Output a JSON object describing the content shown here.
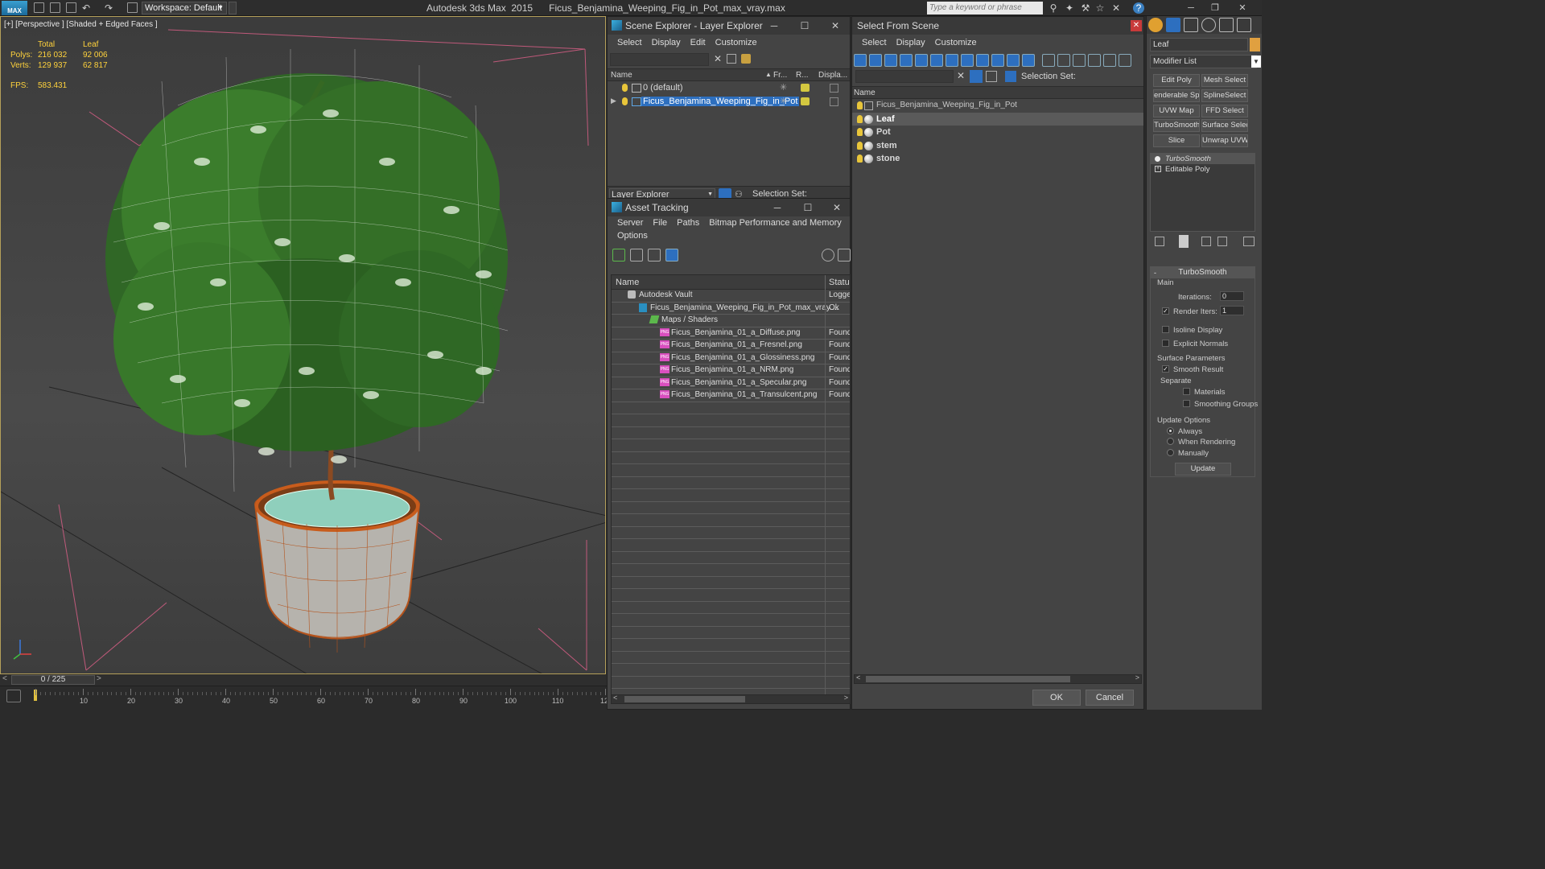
{
  "titlebar": {
    "workspace": "Workspace: Default",
    "app_name": "Autodesk 3ds Max  2015",
    "file_name": "Ficus_Benjamina_Weeping_Fig_in_Pot_max_vray.max",
    "search_placeholder": "Type a keyword or phrase",
    "logo_text": "MAX"
  },
  "viewport": {
    "label": "[+] [Perspective ] [Shaded + Edged Faces ]",
    "stats_headers": [
      "Total",
      "Leaf"
    ],
    "stats": [
      {
        "label": "Polys:",
        "total": "216 032",
        "selected": "92 006"
      },
      {
        "label": "Verts:",
        "total": "129 937",
        "selected": "62 817"
      }
    ],
    "fps_label": "FPS:",
    "fps_value": "583.431"
  },
  "timeline": {
    "frame": "0 / 225",
    "ticks": [
      "10",
      "20",
      "30",
      "40",
      "50",
      "60",
      "70",
      "80",
      "90",
      "100",
      "110",
      "12"
    ]
  },
  "scene_explorer": {
    "title": "Scene Explorer - Layer Explorer",
    "menu": [
      "Select",
      "Display",
      "Edit",
      "Customize"
    ],
    "columns": [
      "Name",
      "Fr...",
      "R...",
      "Displa..."
    ],
    "rows": [
      {
        "name": "0 (default)"
      },
      {
        "name": "Ficus_Benjamina_Weeping_Fig_in_Pot"
      }
    ],
    "footer_mode": "Layer Explorer",
    "selection_set_label": "Selection Set:"
  },
  "asset_tracking": {
    "title": "Asset Tracking",
    "menu": [
      "Server",
      "File",
      "Paths",
      "Bitmap Performance and Memory"
    ],
    "menu2": [
      "Options"
    ],
    "columns": [
      "Name",
      "Status"
    ],
    "rows": [
      {
        "name": "Autodesk Vault",
        "status": "Logge"
      },
      {
        "name": "Ficus_Benjamina_Weeping_Fig_in_Pot_max_vray....",
        "status": "Ok"
      },
      {
        "name": "Maps / Shaders",
        "status": ""
      },
      {
        "name": "Ficus_Benjamina_01_a_Diffuse.png",
        "status": "Found"
      },
      {
        "name": "Ficus_Benjamina_01_a_Fresnel.png",
        "status": "Found"
      },
      {
        "name": "Ficus_Benjamina_01_a_Glossiness.png",
        "status": "Found"
      },
      {
        "name": "Ficus_Benjamina_01_a_NRM.png",
        "status": "Found"
      },
      {
        "name": "Ficus_Benjamina_01_a_Specular.png",
        "status": "Found"
      },
      {
        "name": "Ficus_Benjamina_01_a_Transulcent.png",
        "status": "Found"
      }
    ],
    "png_badge": "PNG"
  },
  "select_from_scene": {
    "title": "Select From Scene",
    "menu": [
      "Select",
      "Display",
      "Customize"
    ],
    "selection_set_label": "Selection Set:",
    "column": "Name",
    "rows": [
      {
        "name": "Ficus_Benjamina_Weeping_Fig_in_Pot"
      },
      {
        "name": "Leaf"
      },
      {
        "name": "Pot"
      },
      {
        "name": "stem"
      },
      {
        "name": "stone"
      }
    ],
    "ok": "OK",
    "cancel": "Cancel"
  },
  "command_panel": {
    "object_name": "Leaf",
    "object_color": "#e0a040",
    "modifier_list": "Modifier List",
    "modifier_buttons": [
      "Edit Poly",
      "Mesh Select",
      "enderable Splir",
      "SplineSelect",
      "UVW Map",
      "FFD Select",
      "TurboSmooth",
      "Surface Select",
      "Slice",
      "Unwrap UVW"
    ],
    "stack": [
      "TurboSmooth",
      "Editable Poly"
    ],
    "rollout_title": "TurboSmooth",
    "main_label": "Main",
    "iterations_label": "Iterations:",
    "iterations_value": "0",
    "render_iters_label": "Render Iters:",
    "render_iters_value": "1",
    "isoline_label": "Isoline Display",
    "explicit_normals_label": "Explicit Normals",
    "surface_params_label": "Surface Parameters",
    "smooth_result_label": "Smooth Result",
    "separate_label": "Separate",
    "materials_label": "Materials",
    "smoothing_groups_label": "Smoothing Groups",
    "update_options_label": "Update Options",
    "always_label": "Always",
    "when_rendering_label": "When Rendering",
    "manually_label": "Manually",
    "update_button": "Update"
  }
}
